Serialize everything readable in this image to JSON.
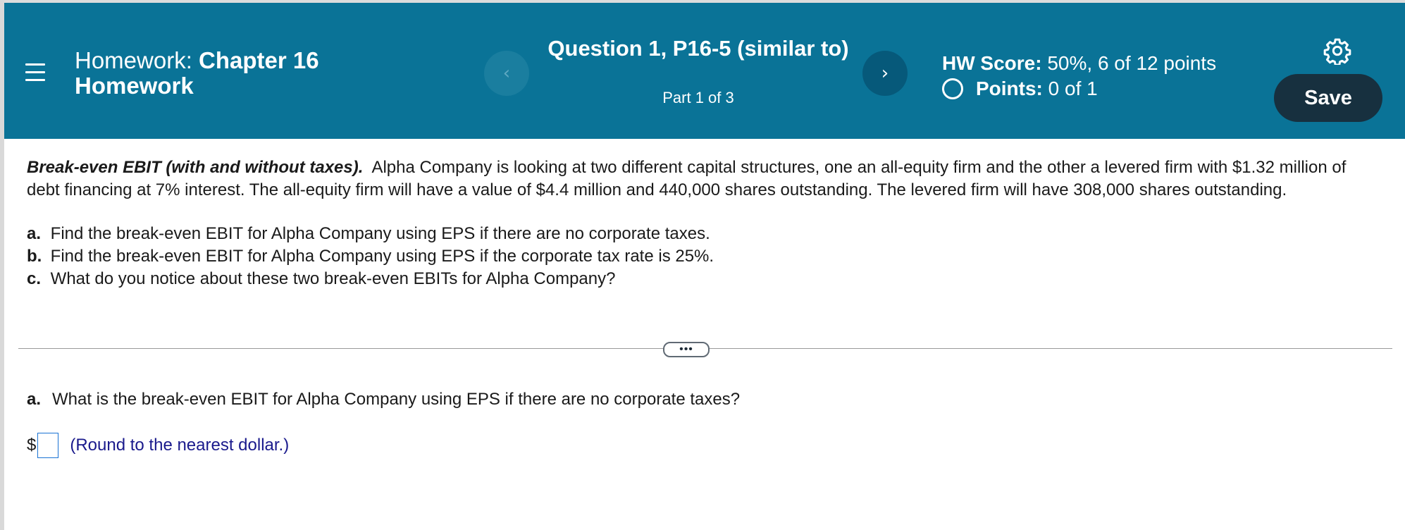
{
  "header": {
    "homework_prefix": "Homework:",
    "homework_name_line1": "Chapter 16",
    "homework_name_line2": "Homework",
    "question_title": "Question 1, P16-5 (similar to)",
    "part_label": "Part 1 of 3",
    "prev_symbol": "‹",
    "next_symbol": "›",
    "hw_score_label": "HW Score:",
    "hw_score_value": "50%, 6 of 12 points",
    "points_label": "Points:",
    "points_value": "0 of 1",
    "save_label": "Save",
    "colors": {
      "bar": "#0a7397",
      "save_button": "#17303f",
      "next_button": "#06597a"
    },
    "icons": [
      "menu-icon",
      "chevron-left-icon",
      "chevron-right-icon",
      "gear-icon",
      "circle-icon"
    ]
  },
  "problem": {
    "lead": "Break-even EBIT (with and without taxes).",
    "text": "Alpha Company is looking at two different capital structures, one an all-equity firm and the other a levered firm with $1.32 million of debt financing at 7% interest.  The all-equity firm will have a value of $4.4 million and 440,000 shares outstanding.  The levered firm will have 308,000 shares outstanding.",
    "parts": [
      {
        "letter": "a.",
        "text": "Find the break-even EBIT for Alpha Company using EPS if there are no corporate taxes."
      },
      {
        "letter": "b.",
        "text": "Find the break-even EBIT for Alpha Company using EPS if the corporate tax rate is 25%."
      },
      {
        "letter": "c.",
        "text": "What do you notice about these two break-even EBITs for Alpha Company?"
      }
    ]
  },
  "more_button_label": "•••",
  "question": {
    "letter": "a.",
    "text": "What is the break-even EBIT for Alpha Company using EPS if there are no corporate taxes?"
  },
  "answer": {
    "currency": "$",
    "value": "",
    "hint": "(Round to the nearest dollar.)"
  }
}
